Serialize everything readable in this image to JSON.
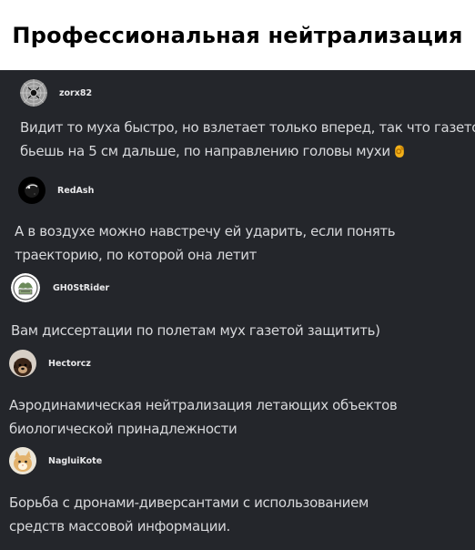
{
  "title": "Профессиональная нейтрализация",
  "comments": [
    {
      "username": "zorx82",
      "avatar": "spider-web-avatar",
      "lines": [
        "Видит то муха быстро, но взлетает только вперед, так что газетой",
        "бьешь на 5 см дальше, по направлению головы мухи"
      ],
      "emoji": "ok-hand-emoji"
    },
    {
      "username": "RedAsh",
      "avatar": "dark-planet-avatar",
      "lines": [
        "А в воздухе можно навстречу ей ударить, если понять",
        "траекторию, по которой она летит"
      ]
    },
    {
      "username": "GH0StRider",
      "avatar": "badge-emblem-avatar",
      "lines": [
        "Вам диссертации по полетам мух газетой защитить)"
      ]
    },
    {
      "username": "Hectorcz",
      "avatar": "dog-photo-avatar",
      "lines": [
        "Аэродинамическая нейтрализация летающих объектов",
        "биологической принадлежности"
      ]
    },
    {
      "username": "NagluiKote",
      "avatar": "cat-photo-avatar",
      "lines": [
        "Борьба с дронами-диверсантами с использованием",
        "средств массовой информации."
      ]
    }
  ]
}
